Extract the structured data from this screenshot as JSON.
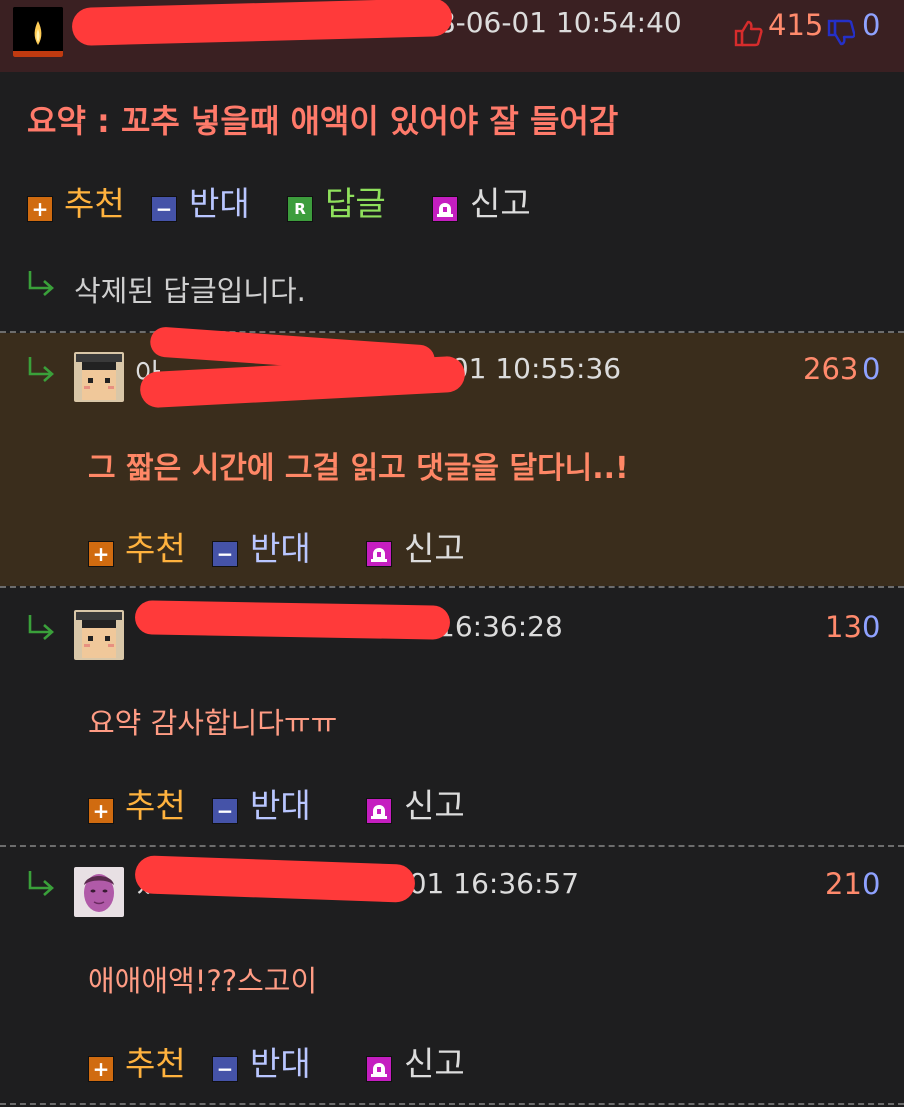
{
  "colors": {
    "bg": "#1e1e1f",
    "top_comment_bg": "#3a2022",
    "highlight_reply_bg": "#3a2d1c",
    "recommend": "#ffb23e",
    "oppose": "#b9c6ff",
    "reply": "#8fe05c",
    "comment_text": "#ff7a6a"
  },
  "icons": {
    "recommend": "plus-icon",
    "oppose": "minus-icon",
    "reply": "reply-r-icon",
    "report": "siren-icon",
    "thumb_up": "thumb-up-icon",
    "thumb_down": "thumb-down-icon",
    "reply_arrow": "reply-arrow-icon"
  },
  "actions": {
    "recommend": "추천",
    "oppose": "반대",
    "reply": "답글",
    "report": "신고",
    "reply_box": "R"
  },
  "comments": [
    {
      "timestamp_visible": "18-06-01 10:54:40",
      "text": "요약 : 꼬추 넣을때 애액이 있어야 잘 들어감",
      "upvotes": "415",
      "downvotes": "0"
    },
    {
      "deleted_text": "삭제된 답글입니다."
    },
    {
      "name_visible": "아",
      "timestamp_visible": "-06-01 10:55:36",
      "text": "그 짧은 시간에 그걸 읽고 댓글을 달다니..!",
      "upvotes": "263",
      "downvotes": "0"
    },
    {
      "timestamp_visible": "16:36:28",
      "text": "요약 감사합니다ㅠㅠ",
      "upvotes": "13",
      "downvotes": "0"
    },
    {
      "name_visible": "ㅆ",
      "timestamp_visible": "06-01 16:36:57",
      "text": "애애애액!??스고이",
      "upvotes": "21",
      "downvotes": "0"
    }
  ]
}
